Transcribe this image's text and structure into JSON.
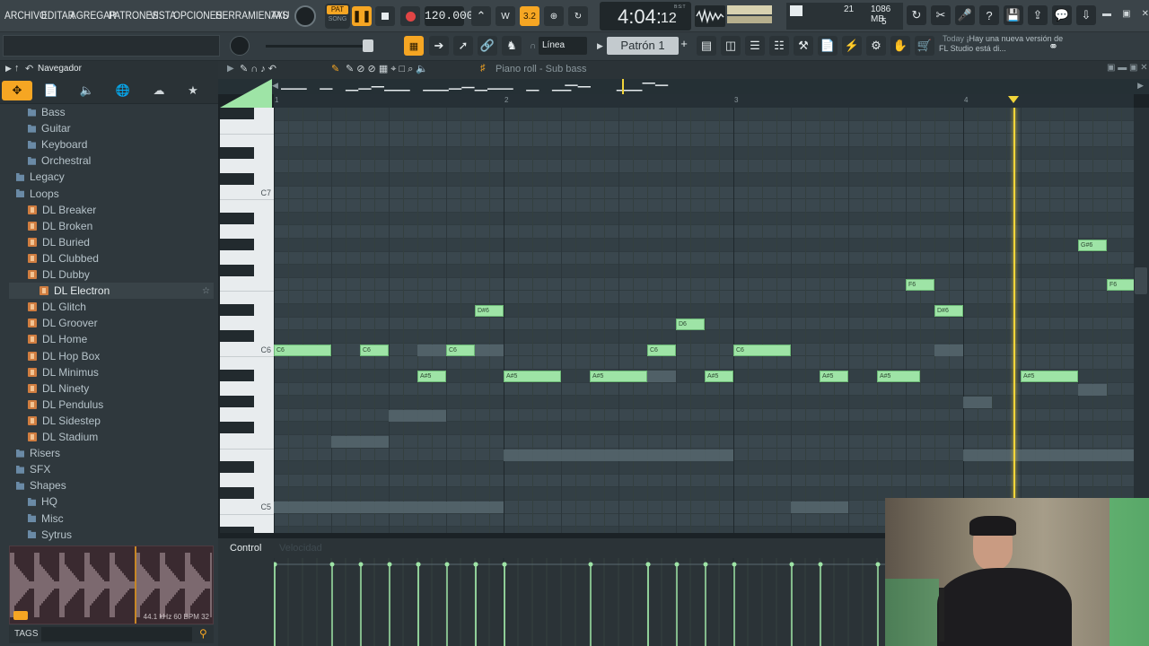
{
  "menu": {
    "items": [
      "ARCHIVO",
      "EDITAR",
      "AGREGAR",
      "PATRONES",
      "VISTA",
      "OPCIONES",
      "HERRAMIENTAS",
      "AYU"
    ]
  },
  "transport": {
    "pat_label": "PAT",
    "song_label": "SONG",
    "tempo": "120.000",
    "time_main": "4:04:",
    "time_ticks": "12",
    "time_unit": "B:S:T",
    "step_label": "3.2"
  },
  "perf": {
    "cpu": "21",
    "ram": "1086 MB",
    "poly": "5"
  },
  "toolbar2": {
    "snap_label": "Línea",
    "pattern_name": "Patrón 1",
    "plus_label": "+"
  },
  "news": {
    "date": "Today",
    "text": "¡Hay una nueva versión de FL Studio está di..."
  },
  "browser": {
    "title": "Navegador",
    "tree": [
      {
        "label": "Bass",
        "type": "folder",
        "indent": 2
      },
      {
        "label": "Guitar",
        "type": "folder",
        "indent": 2
      },
      {
        "label": "Keyboard",
        "type": "folder",
        "indent": 2
      },
      {
        "label": "Orchestral",
        "type": "folder",
        "indent": 2
      },
      {
        "label": "Legacy",
        "type": "folder",
        "indent": 1
      },
      {
        "label": "Loops",
        "type": "folder",
        "indent": 1
      },
      {
        "label": "DL Breaker",
        "type": "pack",
        "indent": 2
      },
      {
        "label": "DL Broken",
        "type": "pack",
        "indent": 2
      },
      {
        "label": "DL Buried",
        "type": "pack",
        "indent": 2
      },
      {
        "label": "DL Clubbed",
        "type": "pack",
        "indent": 2
      },
      {
        "label": "DL Dubby",
        "type": "pack",
        "indent": 2
      },
      {
        "label": "DL Electron",
        "type": "pack",
        "indent": 3,
        "selected": true
      },
      {
        "label": "DL Glitch",
        "type": "pack",
        "indent": 2
      },
      {
        "label": "DL Groover",
        "type": "pack",
        "indent": 2
      },
      {
        "label": "DL Home",
        "type": "pack",
        "indent": 2
      },
      {
        "label": "DL Hop Box",
        "type": "pack",
        "indent": 2
      },
      {
        "label": "DL Minimus",
        "type": "pack",
        "indent": 2
      },
      {
        "label": "DL Ninety",
        "type": "pack",
        "indent": 2
      },
      {
        "label": "DL Pendulus",
        "type": "pack",
        "indent": 2
      },
      {
        "label": "DL Sidestep",
        "type": "pack",
        "indent": 2
      },
      {
        "label": "DL Stadium",
        "type": "pack",
        "indent": 2
      },
      {
        "label": "Risers",
        "type": "folder",
        "indent": 1
      },
      {
        "label": "SFX",
        "type": "folder",
        "indent": 1
      },
      {
        "label": "Shapes",
        "type": "folder",
        "indent": 1
      },
      {
        "label": "HQ",
        "type": "folder",
        "indent": 2
      },
      {
        "label": "Misc",
        "type": "folder",
        "indent": 2
      },
      {
        "label": "Sytrus",
        "type": "folder",
        "indent": 2
      }
    ],
    "sample_info": "44.1 kHz 60 BPM 32",
    "tags_label": "TAGS"
  },
  "piano_roll": {
    "title": "Piano roll - Sub bass",
    "bars": [
      "1",
      "2",
      "3",
      "4"
    ],
    "key_labels": [
      "C7",
      "C6",
      "C5"
    ],
    "notes": [
      {
        "label": "C6",
        "start": 1.0,
        "len": 0.25,
        "pitch": "C6"
      },
      {
        "label": "C6",
        "start": 1.375,
        "len": 0.125,
        "pitch": "C6"
      },
      {
        "label": "A#5",
        "start": 1.625,
        "len": 0.125,
        "pitch": "A#5"
      },
      {
        "label": "C6",
        "start": 1.75,
        "len": 0.125,
        "pitch": "C6"
      },
      {
        "label": "D#6",
        "start": 1.875,
        "len": 0.125,
        "pitch": "D#6"
      },
      {
        "label": "A#5",
        "start": 2.0,
        "len": 0.25,
        "pitch": "A#5"
      },
      {
        "label": "A#5",
        "start": 2.375,
        "len": 0.25,
        "pitch": "A#5"
      },
      {
        "label": "C6",
        "start": 2.625,
        "len": 0.125,
        "pitch": "C6"
      },
      {
        "label": "D6",
        "start": 2.75,
        "len": 0.125,
        "pitch": "D6"
      },
      {
        "label": "A#5",
        "start": 2.875,
        "len": 0.125,
        "pitch": "A#5"
      },
      {
        "label": "C6",
        "start": 3.0,
        "len": 0.25,
        "pitch": "C6"
      },
      {
        "label": "A#5",
        "start": 3.375,
        "len": 0.125,
        "pitch": "A#5"
      },
      {
        "label": "A#5",
        "start": 3.625,
        "len": 0.1875,
        "pitch": "A#5"
      },
      {
        "label": "F6",
        "start": 3.75,
        "len": 0.125,
        "pitch": "F6"
      },
      {
        "label": "D#6",
        "start": 3.875,
        "len": 0.125,
        "pitch": "D#6"
      },
      {
        "label": "A#5",
        "start": 4.25,
        "len": 0.25,
        "pitch": "A#5"
      },
      {
        "label": "G#6",
        "start": 4.5,
        "len": 0.125,
        "pitch": "G#6"
      },
      {
        "label": "F6",
        "start": 4.625,
        "len": 0.125,
        "pitch": "F6"
      }
    ],
    "ghost_notes": [
      {
        "start": 1.25,
        "len": 0.25,
        "pitch": "F5"
      },
      {
        "start": 1.5,
        "len": 0.25,
        "pitch": "G5"
      },
      {
        "start": 1.625,
        "len": 0.125,
        "pitch": "C6"
      },
      {
        "start": 1.875,
        "len": 0.125,
        "pitch": "C6"
      },
      {
        "start": 1.0,
        "len": 1.0,
        "pitch": "C5"
      },
      {
        "start": 2.0,
        "len": 1.0,
        "pitch": "E5"
      },
      {
        "start": 2.625,
        "len": 0.125,
        "pitch": "A#5"
      },
      {
        "start": 3.25,
        "len": 0.25,
        "pitch": "C5"
      },
      {
        "start": 3.875,
        "len": 0.125,
        "pitch": "C6"
      },
      {
        "start": 4.0,
        "len": 0.125,
        "pitch": "G#5"
      },
      {
        "start": 4.0,
        "len": 0.75,
        "pitch": "E5"
      },
      {
        "start": 4.5,
        "len": 0.125,
        "pitch": "A5"
      }
    ],
    "playhead_pos": 4.22,
    "control_label": "Control",
    "velocity_label": "Velocidad"
  },
  "colors": {
    "note": "#9ee4a6",
    "playhead": "#f2d53a",
    "accent_orange": "#f6a623",
    "record": "#e04545"
  }
}
